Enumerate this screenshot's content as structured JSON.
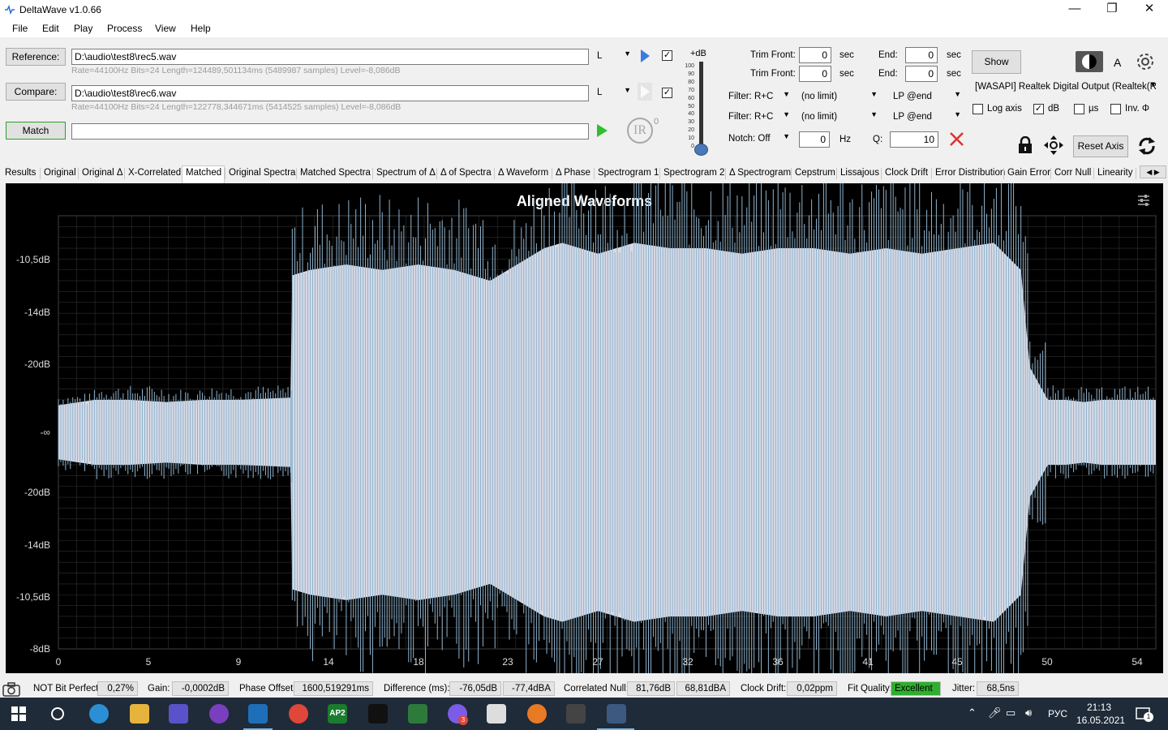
{
  "window": {
    "title": "DeltaWave v1.0.66",
    "minimize": "—",
    "maximize": "❐",
    "close": "✕"
  },
  "menu": [
    "File",
    "Edit",
    "Play",
    "Process",
    "View",
    "Help"
  ],
  "reference": {
    "button": "Reference:",
    "path": "D:\\audio\\test8\\rec5.wav",
    "channel": "L",
    "info": "Rate=44100Hz Bits=24 Length=124489,501134ms (5489987 samples) Level=-8,086dB",
    "checked": true
  },
  "compare": {
    "button": "Compare:",
    "path": "D:\\audio\\test8\\rec6.wav",
    "channel": "L",
    "info": "Rate=44100Hz Bits=24 Length=122778,344671ms (5414525 samples) Level=-8,086dB",
    "checked": true
  },
  "match": {
    "button": "Match",
    "value": ""
  },
  "ir": {
    "label": "IR",
    "exponent": "0"
  },
  "db_slider": {
    "label": "+dB",
    "ticks": [
      "100",
      "90",
      "80",
      "70",
      "60",
      "50",
      "40",
      "30",
      "20",
      "10",
      "0"
    ],
    "level": 0
  },
  "trim": {
    "front_label": "Trim Front:",
    "end_label": "End:",
    "unit": "sec",
    "ref_front": "0",
    "ref_end": "0",
    "cmp_front": "0",
    "cmp_end": "0"
  },
  "filters": {
    "row1": {
      "type": "Filter: R+C",
      "limit": "(no limit)",
      "lp": "LP @end"
    },
    "row2": {
      "type": "Filter: R+C",
      "limit": "(no limit)",
      "lp": "LP @end"
    },
    "notch": {
      "type": "Notch: Off",
      "hz": "0",
      "hz_unit": "Hz",
      "q_label": "Q:",
      "q": "10"
    }
  },
  "output": {
    "show": "Show",
    "device": "[WASAPI] Realtek Digital Output (Realtek(R",
    "a_label": "A",
    "log_axis": {
      "label": "Log axis",
      "checked": false
    },
    "db": {
      "label": "dB",
      "checked": true
    },
    "us": {
      "label": "µs",
      "checked": false
    },
    "inv": {
      "label": "Inv. Φ",
      "checked": false
    },
    "reset_axis": "Reset Axis"
  },
  "tabs": [
    "Results",
    "Original",
    "Original Δ",
    "X-Correlated",
    "Matched",
    "Original Spectra",
    "Matched Spectra",
    "Spectrum of Δ",
    "Δ of Spectra",
    "Δ Waveform",
    "Δ Phase",
    "Spectrogram 1",
    "Spectrogram 2",
    "Δ Spectrogram",
    "Cepstrum",
    "Lissajous",
    "Clock Drift",
    "Error Distribution",
    "Gain Error",
    "Corr Null",
    "Linearity",
    "I"
  ],
  "active_tab": "Matched",
  "chart_data": {
    "type": "area",
    "title": "Aligned Waveforms",
    "ytick_labels": [
      "-10,5dB",
      "-14dB",
      "-20dB",
      "-∞",
      "-20dB",
      "-14dB",
      "-10,5dB",
      "-8dB"
    ],
    "xticks": [
      "0",
      "5",
      "9",
      "14",
      "18",
      "23",
      "27",
      "32",
      "36",
      "41",
      "45",
      "50",
      "54"
    ],
    "xlim": [
      0,
      61
    ],
    "grid": true,
    "envelope": {
      "x": [
        0,
        2,
        4,
        6,
        8,
        10,
        12.9,
        13,
        14,
        16,
        18,
        20,
        22,
        24,
        26,
        27,
        28,
        30,
        32,
        34,
        36,
        38,
        40,
        42,
        44,
        46,
        48,
        50,
        52,
        53.5,
        54,
        55,
        56,
        57,
        58,
        59,
        60,
        61
      ],
      "upper": [
        0.25,
        0.3,
        0.3,
        0.28,
        0.3,
        0.3,
        0.32,
        1.45,
        1.5,
        1.55,
        1.5,
        1.55,
        1.5,
        1.4,
        1.6,
        1.7,
        1.75,
        1.65,
        1.75,
        1.7,
        1.7,
        1.65,
        1.7,
        1.7,
        1.65,
        1.7,
        1.65,
        1.7,
        1.75,
        1.5,
        0.6,
        0.3,
        0.3,
        0.28,
        0.3,
        0.3,
        0.3,
        0.3
      ],
      "lower": [
        0.25,
        0.3,
        0.3,
        0.28,
        0.3,
        0.3,
        0.32,
        1.45,
        1.5,
        1.55,
        1.5,
        1.55,
        1.5,
        1.4,
        1.6,
        1.7,
        1.75,
        1.65,
        1.75,
        1.7,
        1.7,
        1.65,
        1.7,
        1.7,
        1.65,
        1.7,
        1.65,
        1.7,
        1.75,
        1.5,
        0.6,
        0.3,
        0.3,
        0.28,
        0.3,
        0.3,
        0.3,
        0.3
      ]
    },
    "colors": {
      "fill": "#d9dbe6",
      "peaks": "#8fb2cc",
      "grid": "#2f2f2f",
      "background": "#000000"
    }
  },
  "status": {
    "bit_perfect": "NOT Bit Perfect",
    "bit_perfect_val": "0,27%",
    "gain_label": "Gain:",
    "gain": "-0,0002dB",
    "phase_label": "Phase Offset:",
    "phase": "1600,519291ms",
    "diff_label": "Difference (ms):",
    "diff1": "-76,05dB",
    "diff2": "-77,4dBA",
    "null_label": "Correlated Null:",
    "null1": "81,76dB",
    "null2": "68,81dBA",
    "clock_label": "Clock Drift:",
    "clock": "0,02ppm",
    "fit_label": "Fit Quality:",
    "fit": "Excellent",
    "jitter_label": "Jitter:",
    "jitter": "68,5ns"
  },
  "taskbar": {
    "lang": "РУС",
    "time": "21:13",
    "date": "16.05.2021",
    "notif_count": "1",
    "badge": "3",
    "ap_label": "AP2"
  }
}
